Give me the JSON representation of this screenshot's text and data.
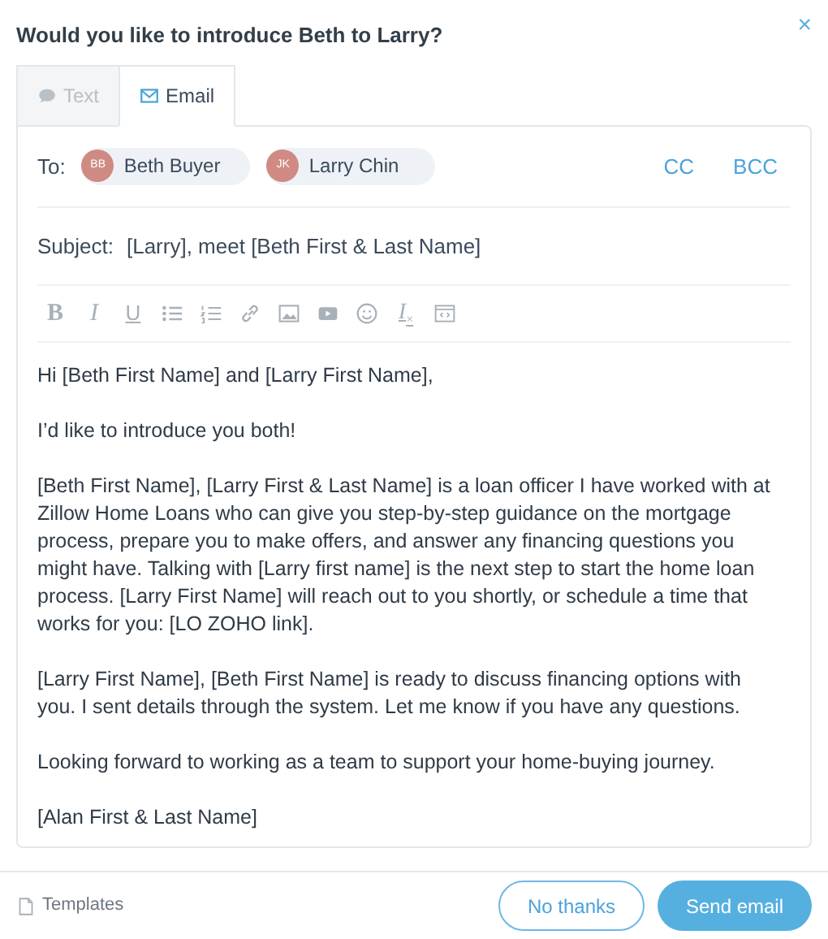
{
  "dialog": {
    "title": "Would you like to introduce Beth to Larry?",
    "close": "×"
  },
  "tabs": [
    {
      "kind": "text",
      "label": "Text",
      "selected": false
    },
    {
      "kind": "email",
      "label": "Email",
      "selected": true
    }
  ],
  "to": {
    "label": "To:",
    "recipients": [
      {
        "initials": "BB",
        "name": "Beth Buyer",
        "color": "#d08a84"
      },
      {
        "initials": "JK",
        "name": "Larry Chin",
        "color": "#d08a84"
      }
    ],
    "cc": "CC",
    "bcc": "BCC"
  },
  "subject": {
    "label": "Subject:",
    "value": "[Larry], meet [Beth First & Last Name]"
  },
  "toolbar": [
    {
      "kind": "bold",
      "glyph": "B"
    },
    {
      "kind": "italic",
      "glyph": "I"
    },
    {
      "kind": "underline",
      "glyph": "U"
    },
    {
      "kind": "bullets"
    },
    {
      "kind": "numbers"
    },
    {
      "kind": "link"
    },
    {
      "kind": "image"
    },
    {
      "kind": "video"
    },
    {
      "kind": "emoji"
    },
    {
      "kind": "clear",
      "glyph": "I",
      "mark": "×"
    },
    {
      "kind": "source"
    }
  ],
  "body": [
    "Hi [Beth First Name] and [Larry First Name],",
    "I’d like to introduce you both!",
    "[Beth First Name], [Larry First & Last Name] is a loan officer I have worked with at Zillow Home Loans who can give you step-by-step guidance on the mortgage process, prepare you to make offers, and answer any financing questions you might have. Talking with [Larry first name] is the next step to start the home loan process. [Larry First Name] will reach out to you shortly, or schedule a time that works for you: [LO ZOHO link].",
    "[Larry First Name], [Beth First Name] is ready to discuss financing options with you.  I sent details through the system. Let me know if you have any questions.",
    "Looking forward to working as a team to support your home-buying journey.",
    "[Alan First & Last Name]"
  ],
  "footer": {
    "templates": "Templates",
    "secondary": "No thanks",
    "primary": "Send email"
  }
}
